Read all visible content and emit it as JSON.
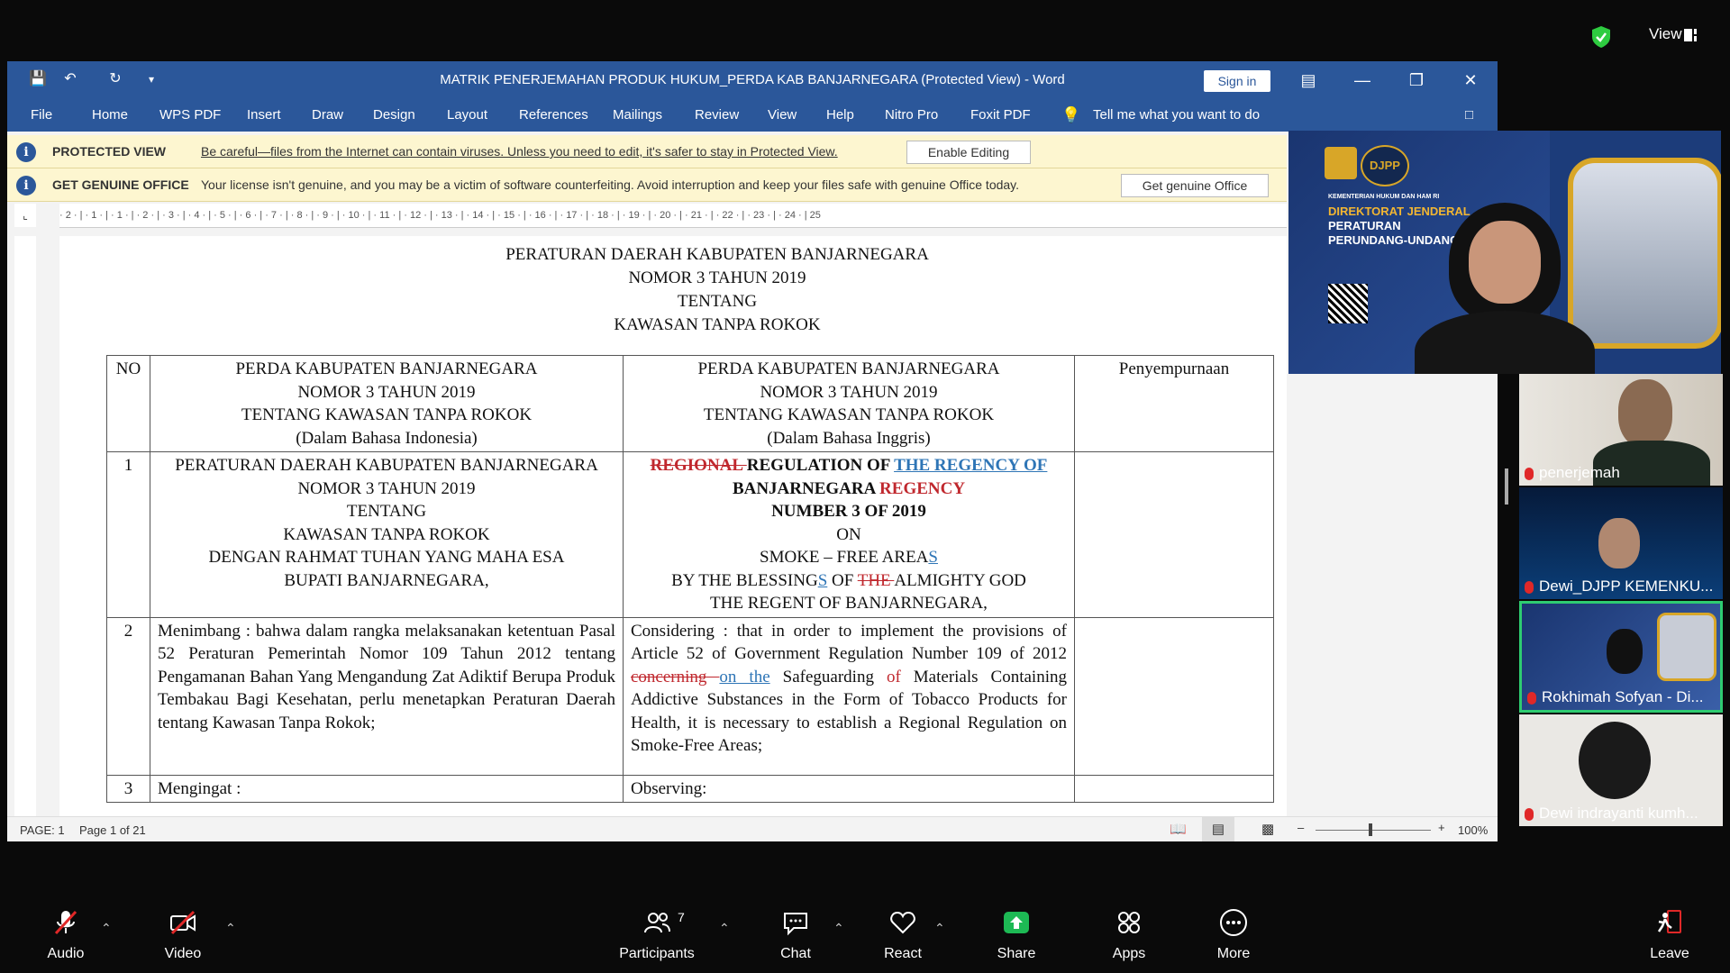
{
  "zoom_top": {
    "view_label": "View"
  },
  "word": {
    "title": "MATRIK PENERJEMAHAN PRODUK HUKUM_PERDA KAB BANJARNEGARA (Protected View)  -  Word",
    "sign_in": "Sign in",
    "menu": [
      "File",
      "Home",
      "WPS PDF",
      "Insert",
      "Draw",
      "Design",
      "Layout",
      "References",
      "Mailings",
      "Review",
      "View",
      "Help",
      "Nitro Pro",
      "Foxit PDF"
    ],
    "tell_me": "Tell me what you want to do",
    "protected_bar": {
      "title": "PROTECTED VIEW",
      "message": "Be careful—files from the Internet can contain viruses. Unless you need to edit, it's safer to stay in Protected View.",
      "button": "Enable Editing"
    },
    "genuine_bar": {
      "title": "GET GENUINE OFFICE",
      "message": "Your license isn't genuine, and you may be a victim of software counterfeiting. Avoid interruption and keep your files safe with genuine Office today.",
      "button": "Get genuine Office"
    },
    "ruler_marks": "· 2 · | · 1 · | · 1 · | · 2 · | · 3 · | · 4 · | · 5 · | · 6 · | · 7 · | · 8 · | · 9 · | · 10 · | · 11 · | · 12 · | · 13 · | · 14 · | · 15 · | · 16 · | · 17 · | · 18 · | · 19 · | · 20 · | · 21 · | · 22 · | · 23 · | · 24 · | 25",
    "status": {
      "page": "PAGE: 1",
      "page_of": "Page 1 of 21",
      "zoom": "100%"
    }
  },
  "document": {
    "heading": [
      "PERATURAN DAERAH KABUPATEN BANJARNEGARA",
      "NOMOR 3 TAHUN 2019",
      "TENTANG",
      "KAWASAN TANPA ROKOK"
    ],
    "header_row": {
      "no": "NO",
      "indonesian": [
        "PERDA KABUPATEN BANJARNEGARA",
        "NOMOR 3 TAHUN 2019",
        "TENTANG KAWASAN TANPA ROKOK",
        "(Dalam Bahasa Indonesia)"
      ],
      "english": [
        "PERDA KABUPATEN BANJARNEGARA",
        "NOMOR 3 TAHUN 2019",
        "TENTANG KAWASAN TANPA ROKOK",
        "(Dalam Bahasa Inggris)"
      ],
      "improvement": "Penyempurnaan"
    },
    "row1": {
      "no": "1",
      "indonesian": [
        "PERATURAN DAERAH KABUPATEN BANJARNEGARA",
        "NOMOR 3 TAHUN 2019",
        "TENTANG",
        "KAWASAN TANPA ROKOK",
        "DENGAN RAHMAT TUHAN YANG MAHA ESA",
        "BUPATI BANJARNEGARA,"
      ],
      "en_del1": "REGIONAL ",
      "en_l1": "REGULATION OF ",
      "en_ins1": "THE REGENCY OF",
      "en_l2": "BANJARNEGARA ",
      "en_del2": "REGENCY",
      "en_l3": "NUMBER 3 OF 2019",
      "en_l4": "ON",
      "en_l5a": "SMOKE – FREE AREA",
      "en_l5b": "S",
      "en_l6a": "BY THE BLESSING",
      "en_l6b": "S",
      "en_l6c": " OF ",
      "en_l6d": "THE ",
      "en_l6e": "ALMIGHTY GOD",
      "en_l7": "THE REGENT OF BANJARNEGARA,"
    },
    "row2": {
      "no": "2",
      "indonesian": "Menimbang : bahwa dalam rangka melaksanakan ketentuan Pasal 52 Peraturan Pemerintah Nomor 109 Tahun 2012 tentang Pengamanan Bahan Yang Mengandung Zat Adiktif Berupa Produk Tembakau Bagi Kesehatan, perlu menetapkan Peraturan Daerah tentang Kawasan Tanpa Rokok;",
      "en_a": "Considering : that in order to implement the provisions of Article 52 of Government Regulation Number 109 of 2012 ",
      "en_del": "concerning ",
      "en_ins": "on the",
      "en_b": " Safeguarding ",
      "en_del2": "of",
      "en_c": " Materials Containing Addictive Substances in the Form of Tobacco Products for Health, it is necessary to establish a Regional Regulation on Smoke-Free Areas;"
    },
    "row3": {
      "no": "3",
      "indonesian": "Mengingat :",
      "english": "Observing:"
    }
  },
  "presenter_slide": {
    "ministry": "KEMENTERIAN HUKUM DAN HAM RI",
    "logo": "DJPP",
    "line1": "DIREKTORAT JENDERAL",
    "line2": "PERATURAN",
    "line3": "PERUNDANG-UNDANGAN"
  },
  "participants": [
    {
      "name": "penerjemah"
    },
    {
      "name": "Dewi_DJPP KEMENKU..."
    },
    {
      "name": "Rokhimah Sofyan - Di..."
    },
    {
      "name": "Dewi indrayanti kumh..."
    }
  ],
  "bottom_bar": {
    "audio": "Audio",
    "video": "Video",
    "participants": "Participants",
    "participants_count": "7",
    "chat": "Chat",
    "react": "React",
    "share": "Share",
    "apps": "Apps",
    "more": "More",
    "leave": "Leave"
  },
  "colors": {
    "word_blue": "#2b579a",
    "share_green": "#1db954",
    "active_border": "#2ecc71"
  }
}
